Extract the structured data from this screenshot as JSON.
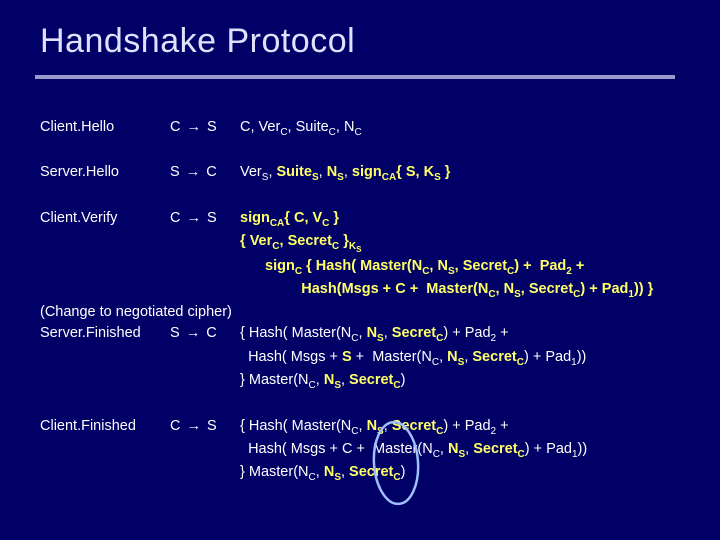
{
  "title": "Handshake Protocol",
  "msgs": {
    "clientHello": {
      "name": "Client.Hello",
      "dir": "C → S"
    },
    "serverHello": {
      "name": "Server.Hello",
      "dir": "S → C"
    },
    "clientVerify": {
      "name": "Client.Verify",
      "dir": "C → S"
    },
    "serverFinished": {
      "name": "Server.Finished",
      "dir": "S → C"
    },
    "clientFinished": {
      "name": "Client.Finished",
      "dir": "C → S"
    }
  },
  "tx": {
    "C": "C",
    "S": "S",
    "Ver": "Ver",
    "Suite": "Suite",
    "N": "N",
    "K": "K",
    "V": "V",
    "Secret": "Secret",
    "sign": "sign",
    "CA": "CA",
    "Hash": "Hash",
    "Master": "Master",
    "Msgs": "Msgs",
    "Pad1": "Pad",
    "Pad2": "Pad",
    "one": "1",
    "two": "2",
    "changeCipher": "(Change to negotiated cipher)",
    "openBrace": "{",
    "closeBraceSp": " }",
    "closeBrace": "}",
    "openParen": "(",
    "closeParen": ")",
    "closeParen2": "))",
    "closeParen3": ")) }",
    "plus": " + ",
    "comma": ", "
  }
}
